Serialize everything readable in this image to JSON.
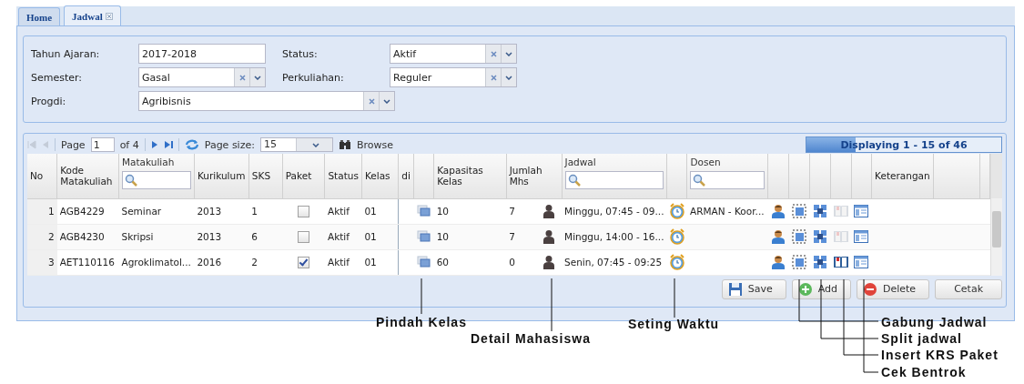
{
  "tabs": [
    {
      "label": "Home",
      "selected": false,
      "closable": false
    },
    {
      "label": "Jadwal",
      "selected": true,
      "closable": true
    }
  ],
  "filters": [
    {
      "label": "Tahun Ajaran:",
      "kind": "text",
      "value": "2017-2018"
    },
    {
      "label": "Status:",
      "kind": "combo",
      "value": "Aktif"
    },
    {
      "label": "Semester:",
      "kind": "combo",
      "value": "Gasal"
    },
    {
      "label": "Perkuliahan:",
      "kind": "combo",
      "value": "Reguler"
    },
    {
      "label": "Progdi:",
      "kind": "combo",
      "value": "Agribisnis"
    }
  ],
  "paging": {
    "page_label": "Page",
    "page": "1",
    "of": "of 4",
    "size_label": "Page size:",
    "size": "15",
    "browse": "Browse",
    "display": "Displaying 1 - 15 of 46",
    "level": 0.25
  },
  "headers": [
    {
      "label": "No",
      "filter": false
    },
    {
      "label": "Kode Matakuliah",
      "filter": false
    },
    {
      "label": "Matakuliah",
      "filter": true
    },
    {
      "label": "Kurikulum",
      "filter": false
    },
    {
      "label": "SKS",
      "filter": false
    },
    {
      "label": "Paket",
      "filter": false
    },
    {
      "label": "Status",
      "filter": false
    },
    {
      "label": "Kelas",
      "filter": false
    },
    {
      "label": "di",
      "filter": false
    },
    {
      "label": "Kapasitas Kelas",
      "filter": false
    },
    {
      "label": "Jumlah Mhs",
      "filter": false
    },
    {
      "label": "Jadwal",
      "filter": true
    },
    {
      "label": "Dosen",
      "filter": true
    },
    {
      "label": "Keterangan",
      "filter": false
    }
  ],
  "rows": [
    {
      "no": "1",
      "kode": "AGB4229",
      "matakuliah": "Seminar",
      "kurikulum": "2013",
      "sks": "1",
      "paket": false,
      "status": "Aktif",
      "kelas": "01",
      "kapasitas": "10",
      "jumlah": "7",
      "jadwal": "Minggu, 07:45 - 09...",
      "dosen": "ARMAN - Koor...",
      "krs_enabled": false
    },
    {
      "no": "2",
      "kode": "AGB4230",
      "matakuliah": "Skripsi",
      "kurikulum": "2013",
      "sks": "6",
      "paket": false,
      "status": "Aktif",
      "kelas": "01",
      "kapasitas": "10",
      "jumlah": "7",
      "jadwal": "Minggu, 14:00 - 16...",
      "krs_enabled": false
    },
    {
      "no": "3",
      "kode": "AET110116",
      "matakuliah": "Agroklimatol...",
      "kurikulum": "2016",
      "sks": "2",
      "paket": true,
      "status": "Aktif",
      "kelas": "01",
      "kapasitas": "60",
      "jumlah": "0",
      "jadwal": "Senin, 07:45 - 09:25",
      "krs_enabled": true
    }
  ],
  "buttons": [
    {
      "label": "Save",
      "kind": "save"
    },
    {
      "label": "Add",
      "kind": "add"
    },
    {
      "label": "Delete",
      "kind": "delete"
    },
    {
      "label": "Cetak",
      "kind": "plain"
    }
  ],
  "annotations": [
    {
      "label": "Pindah Kelas"
    },
    {
      "label": "Detail Mahasiswa"
    },
    {
      "label": "Seting Waktu"
    },
    {
      "label": "Gabung Jadwal"
    },
    {
      "label": "Split jadwal"
    },
    {
      "label": "Insert KRS Paket"
    },
    {
      "label": "Cek Bentrok"
    }
  ]
}
